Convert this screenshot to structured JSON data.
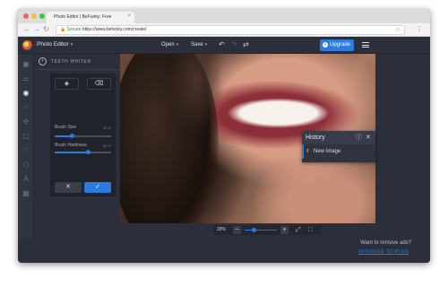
{
  "browser": {
    "tab_title": "Photo Editor | BeFunky: Free",
    "tab_close": "×",
    "traffic_lights": [
      "#fc605c",
      "#fdbc40",
      "#34c84a"
    ],
    "secure_label": "Secure",
    "url": "https://www.befunky.com/create/",
    "bookmark_icon": "☆",
    "menu_icon": "⋮"
  },
  "app": {
    "title": "Photo Editor",
    "menus": [
      "Open",
      "Save"
    ],
    "upgrade_label": "Upgrade",
    "accent": "#2d7be0"
  },
  "sidebar": {
    "icons": [
      "image-icon",
      "adjust-icon",
      "touch-up-icon",
      "effects-icon",
      "artsy-icon",
      "frames-icon",
      "overlays-icon",
      "graphics-icon",
      "text-icon",
      "textures-icon"
    ],
    "active_index": 2
  },
  "panel": {
    "title": "TEETH WHITEN",
    "sliders": [
      {
        "label": "Brush Size",
        "value": "31 %",
        "fraction": 0.31
      },
      {
        "label": "Brush Hardness",
        "value": "60 %",
        "fraction": 0.6
      }
    ]
  },
  "history": {
    "title": "History",
    "items": [
      "New Image"
    ]
  },
  "zoom": {
    "value": "28%",
    "minus": "−",
    "plus": "+",
    "fraction": 0.28
  },
  "footer": {
    "remove_ads": "Want to remove ads?",
    "upgrade_link": "UPGRADE TO PLUS"
  }
}
